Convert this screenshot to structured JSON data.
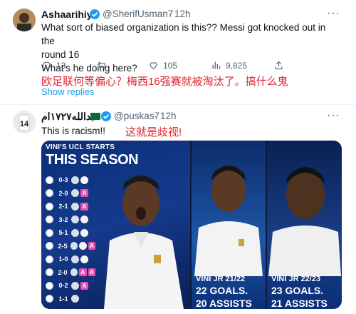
{
  "tweet1": {
    "display_name": "Ashaarihiy",
    "handle": "@SherifUsman7",
    "time": "12h",
    "text_lines": [
      "What sort of biased organization is this?? Messi got knocked out in the",
      "round 16",
      "What's he doing here?"
    ],
    "replies": "13",
    "retweets": "",
    "likes": "105",
    "views": "9,825",
    "translation": "欧足联何等偏心？梅西16强赛就被淘汰了。搞什么鬼",
    "show_replies": "Show replies"
  },
  "tweet2": {
    "display_name": "عبدالله١٧٢٧ام",
    "handle": "@puskas7",
    "time": "12h",
    "text": "This is racism!!",
    "translation": "这就是歧视!",
    "media": {
      "panel1_title": "VINI'S UCL STARTS",
      "panel1_subtitle": "THIS SEASON",
      "results": [
        {
          "score": "0-3",
          "tags": [
            "G"
          ]
        },
        {
          "score": "2-0",
          "tags": [
            "A"
          ]
        },
        {
          "score": "2-1",
          "tags": [
            "A"
          ]
        },
        {
          "score": "3-2",
          "tags": [
            "G"
          ]
        },
        {
          "score": "5-1",
          "tags": [
            "G"
          ]
        },
        {
          "score": "2-5",
          "tags": [
            "G",
            "A"
          ]
        },
        {
          "score": "1-0",
          "tags": [
            "G"
          ]
        },
        {
          "score": "2-0",
          "tags": [
            "A",
            "A"
          ]
        },
        {
          "score": "0-2",
          "tags": [
            "A"
          ]
        },
        {
          "score": "1-1",
          "tags": []
        }
      ],
      "panel2_title": "VINI JR 21/22",
      "panel2_goals": "22 GOALS.",
      "panel2_assists": "20 ASSISTS",
      "panel3_title": "VINI JR 22/23",
      "panel3_goals": "23 GOALS.",
      "panel3_assists": "21 ASSISTS"
    }
  },
  "colors": {
    "accent": "#1d9bf0",
    "translation_red": "#e0242f",
    "muted": "#536471"
  }
}
